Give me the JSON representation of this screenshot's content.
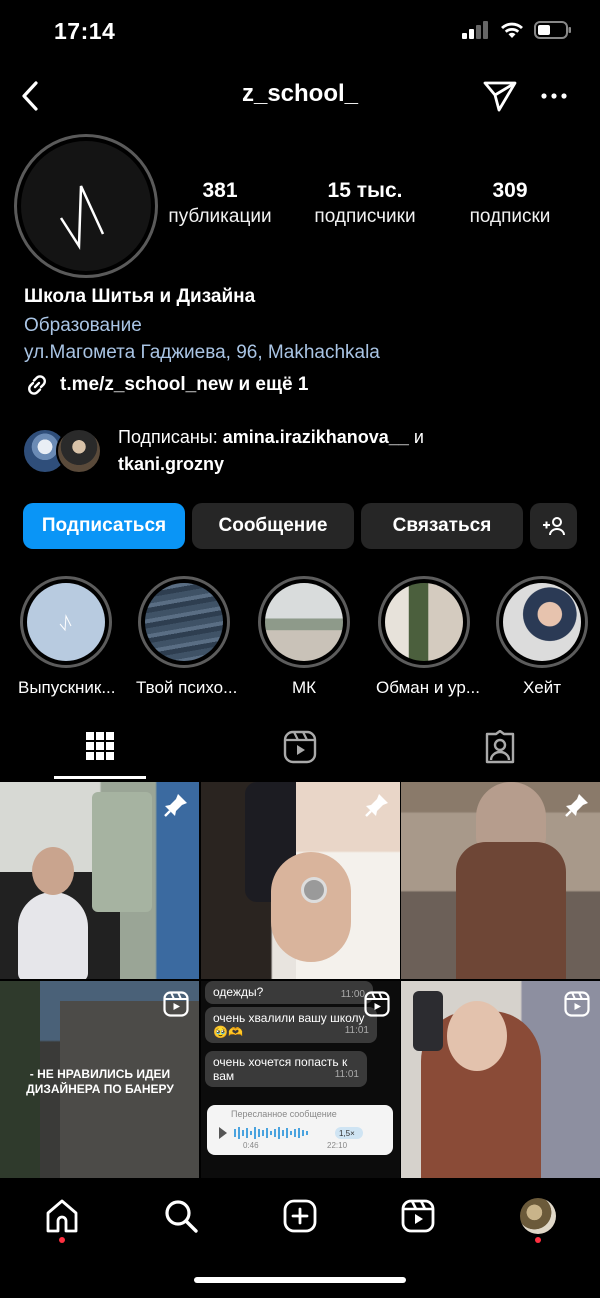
{
  "status": {
    "time": "17:14"
  },
  "header": {
    "username": "z_school_"
  },
  "stats": [
    {
      "value": "381",
      "label": "публикации"
    },
    {
      "value": "15 тыс.",
      "label": "подписчики"
    },
    {
      "value": "309",
      "label": "подписки"
    }
  ],
  "bio": {
    "name": "Школа Шитья и Дизайна",
    "category": "Образование",
    "address": "ул.Магомета Гаджиева, 96, Makhachkala",
    "link": "t.me/z_school_new и ещё 1"
  },
  "followed_by": {
    "prefix": "Подписаны: ",
    "user1": "amina.irazikhanova__",
    "joiner": " и",
    "user2": "tkani.grozny"
  },
  "buttons": {
    "follow": "Подписаться",
    "message": "Сообщение",
    "contact": "Связаться"
  },
  "highlights": [
    {
      "label": "Выпускник..."
    },
    {
      "label": "Твой психо..."
    },
    {
      "label": "МК"
    },
    {
      "label": "Обман и ур..."
    },
    {
      "label": "Хейт"
    }
  ],
  "posts": {
    "banner_text_1": "- НЕ НРАВИЛИСЬ  ИДЕИ",
    "banner_text_2": "ДИЗАЙНЕРА ПО БАНЕРУ",
    "chat": [
      {
        "text": "одежды?",
        "time": "11:00"
      },
      {
        "text": "очень хвалили вашу школу 🥹🫶",
        "time": "11:01"
      },
      {
        "text": "очень хочется попасть к вам",
        "time": "11:01"
      }
    ],
    "forwarded": "Пересланное сообщение",
    "voice_start": "0:46",
    "voice_end": "22:10",
    "voice_speed": "1,5×"
  }
}
